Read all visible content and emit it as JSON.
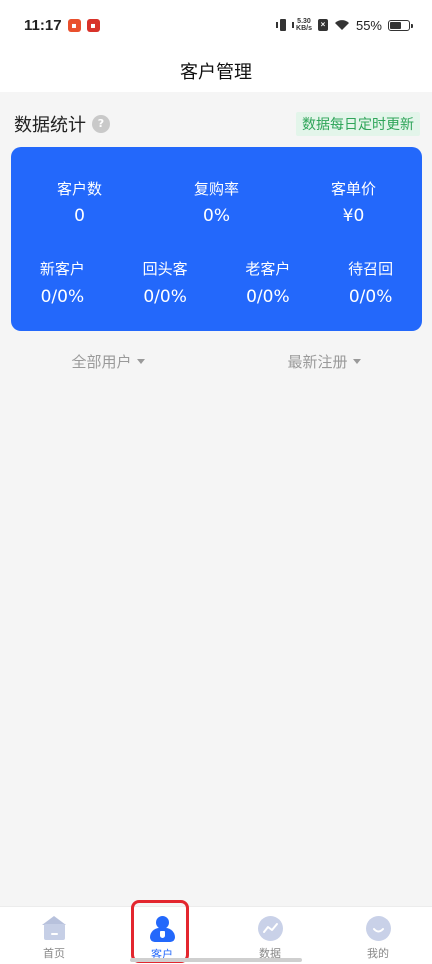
{
  "status_bar": {
    "time": "11:17",
    "net_speed_value": "5.30",
    "net_speed_unit": "KB/s",
    "battery_text": "55%",
    "battery_level": 0.55
  },
  "nav": {
    "title": "客户管理"
  },
  "stats": {
    "title": "数据统计",
    "help_glyph": "?",
    "update_note": "数据每日定时更新",
    "primary": [
      {
        "label": "客户数",
        "value": "0"
      },
      {
        "label": "复购率",
        "value": "0%"
      },
      {
        "label": "客单价",
        "value": "¥0"
      }
    ],
    "secondary": [
      {
        "label": "新客户",
        "value": "0/0%"
      },
      {
        "label": "回头客",
        "value": "0/0%"
      },
      {
        "label": "老客户",
        "value": "0/0%"
      },
      {
        "label": "待召回",
        "value": "0/0%"
      }
    ]
  },
  "filters": [
    {
      "label": "全部用户"
    },
    {
      "label": "最新注册"
    }
  ],
  "tabs": [
    {
      "label": "首页",
      "icon": "home-icon"
    },
    {
      "label": "客户",
      "icon": "customer-icon",
      "active": true
    },
    {
      "label": "数据",
      "icon": "chart-icon"
    },
    {
      "label": "我的",
      "icon": "profile-icon"
    }
  ],
  "colors": {
    "accent": "#2368fb",
    "update_badge_text": "#2fa55a",
    "highlight": "#e3262e"
  }
}
